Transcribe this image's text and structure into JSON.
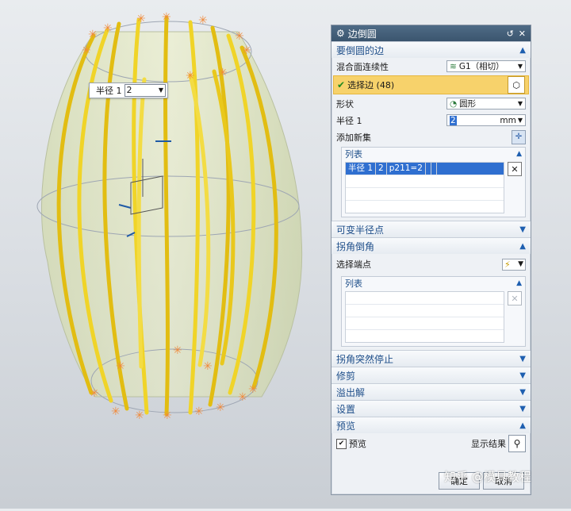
{
  "viewport": {
    "radius_popup": {
      "label": "半径 1",
      "value": "2"
    }
  },
  "dialog": {
    "title": "边倒圆",
    "sections": {
      "edge": {
        "title": "要倒圆的边",
        "blend_continuity_label": "混合面连续性",
        "blend_continuity_value": "G1（相切）",
        "select_edge": "选择边 (48)",
        "shape_label": "形状",
        "shape_value": "圆形",
        "radius_label": "半径 1",
        "radius_value": "2",
        "radius_unit": "mm",
        "add_set_label": "添加新集",
        "list_title": "列表",
        "list_row": [
          "半径 1",
          "2",
          "p211=2"
        ]
      },
      "variable_radius": {
        "title": "可变半径点"
      },
      "corner": {
        "title": "拐角倒角",
        "select_endpoint_label": "选择端点",
        "list_title": "列表"
      },
      "corner_stop": {
        "title": "拐角突然停止"
      },
      "trim": {
        "title": "修剪"
      },
      "overflow": {
        "title": "溢出解"
      },
      "settings": {
        "title": "设置"
      },
      "preview": {
        "title": "预览",
        "preview_checkbox": "预览",
        "show_result": "显示结果"
      }
    },
    "buttons": {
      "ok": "确定",
      "cancel": "取消"
    }
  },
  "watermark": "知乎 @模具教程",
  "colors": {
    "title_bar": "#3b556e",
    "section_text": "#1f4f8a",
    "selected_row": "#f7d26b",
    "model_stroke": "#e6c41a"
  }
}
